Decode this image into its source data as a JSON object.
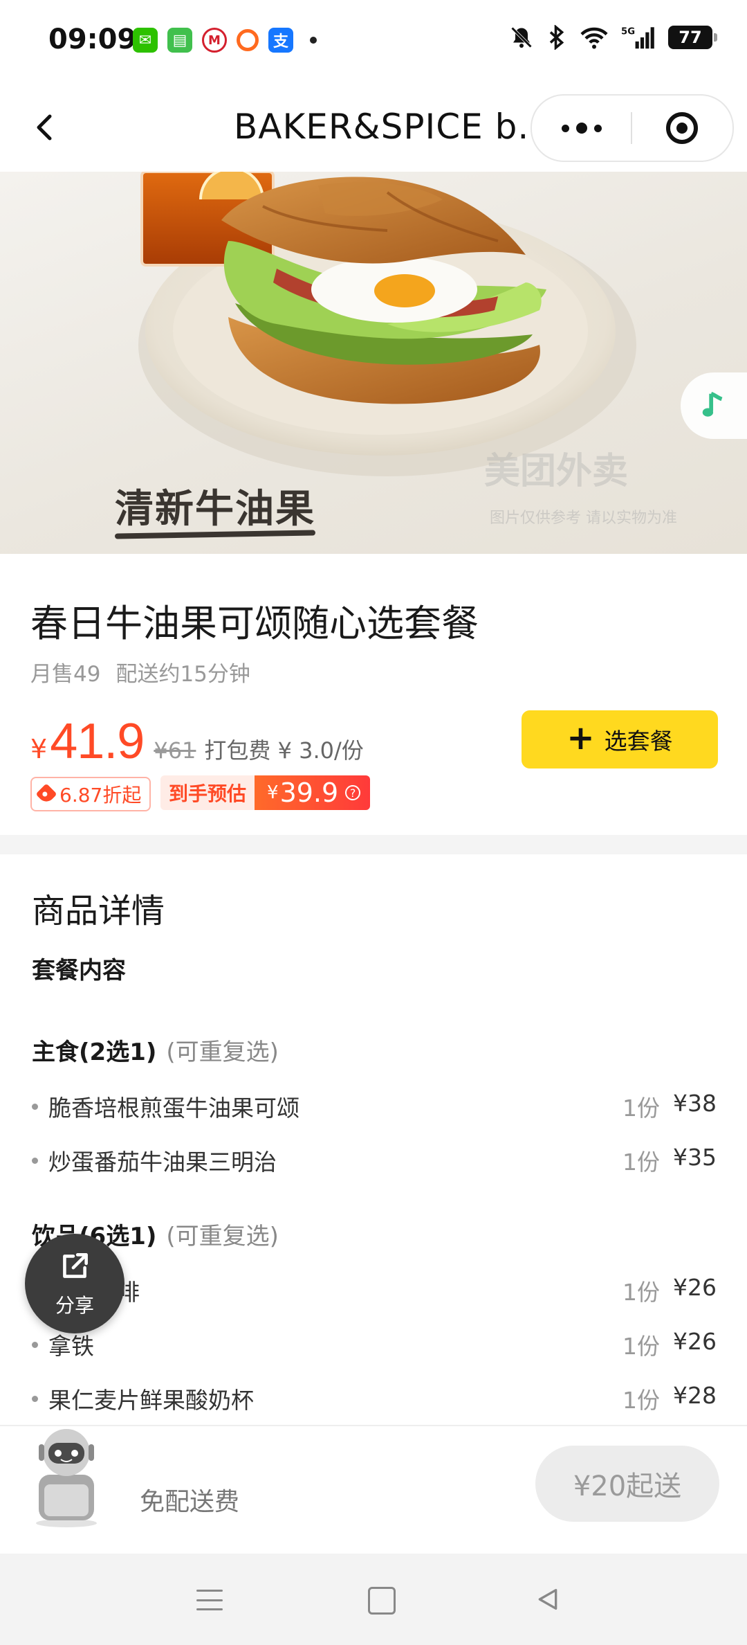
{
  "status_bar": {
    "time": "09:09",
    "battery": "77",
    "network": "5G"
  },
  "nav": {
    "title": "BAKER&SPICE b..."
  },
  "hero": {
    "overlay_text": "清新牛油果",
    "watermark": "美团外卖",
    "watermark_sub": "图片仅供参考 请以实物为准"
  },
  "product": {
    "title": "春日牛油果可颂随心选套餐",
    "monthly_sales": "月售49",
    "delivery_time": "配送约15分钟",
    "currency": "¥",
    "price": "41.9",
    "original_price": "¥61",
    "packing_fee": "打包费 ¥ 3.0/份",
    "select_button": "选套餐",
    "discount": "6.87折起",
    "estimate_label": "到手预估",
    "estimate_price": "39.9"
  },
  "details": {
    "title": "商品详情",
    "subtitle": "套餐内容",
    "groups": [
      {
        "name": "主食(2选1)",
        "note": "(可重复选)",
        "items": [
          {
            "name": "脆香培根煎蛋牛油果可颂",
            "qty": "1份",
            "price": "¥38"
          },
          {
            "name": "炒蛋番茄牛油果三明治",
            "qty": "1份",
            "price": "¥35"
          }
        ]
      },
      {
        "name": "饮品(6选1)",
        "note": "(可重复选)",
        "items": [
          {
            "name": "美式咖啡",
            "qty": "1份",
            "price": "¥26"
          },
          {
            "name": "拿铁",
            "qty": "1份",
            "price": "¥26"
          },
          {
            "name": "果仁麦片鲜果酸奶杯",
            "qty": "1份",
            "price": "¥28"
          }
        ]
      }
    ]
  },
  "share": {
    "label": "分享"
  },
  "cart": {
    "free_delivery": "免配送费",
    "min_order": "¥20起送"
  },
  "colors": {
    "accent": "#ff4a26",
    "button_yellow": "#ffd91f"
  }
}
